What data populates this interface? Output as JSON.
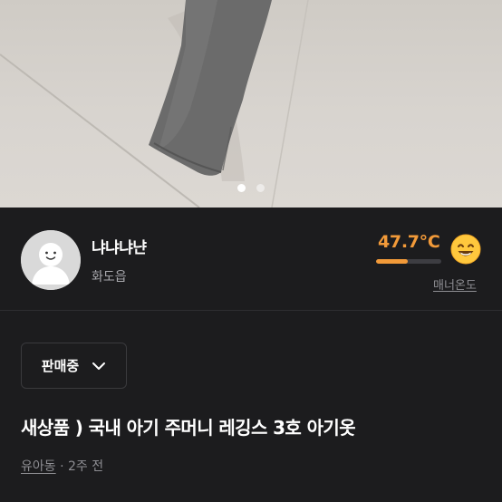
{
  "carousel": {
    "total": 2,
    "active": 0
  },
  "seller": {
    "name": "냐냐냐냔",
    "location": "화도읍",
    "avatar_icon": "default-avatar-icon"
  },
  "manner": {
    "temperature": "47.7°C",
    "temperature_value": 47.7,
    "label": "매너온도",
    "face_icon": "smiley-face-icon",
    "color": "#f29a39"
  },
  "status": {
    "label": "판매중",
    "icon": "chevron-down-icon"
  },
  "listing": {
    "title": "새상품 ) 국내 아기 주머니 레깅스 3호 아기옷",
    "category": "유아동",
    "separator": " · ",
    "time": "2주 전"
  }
}
